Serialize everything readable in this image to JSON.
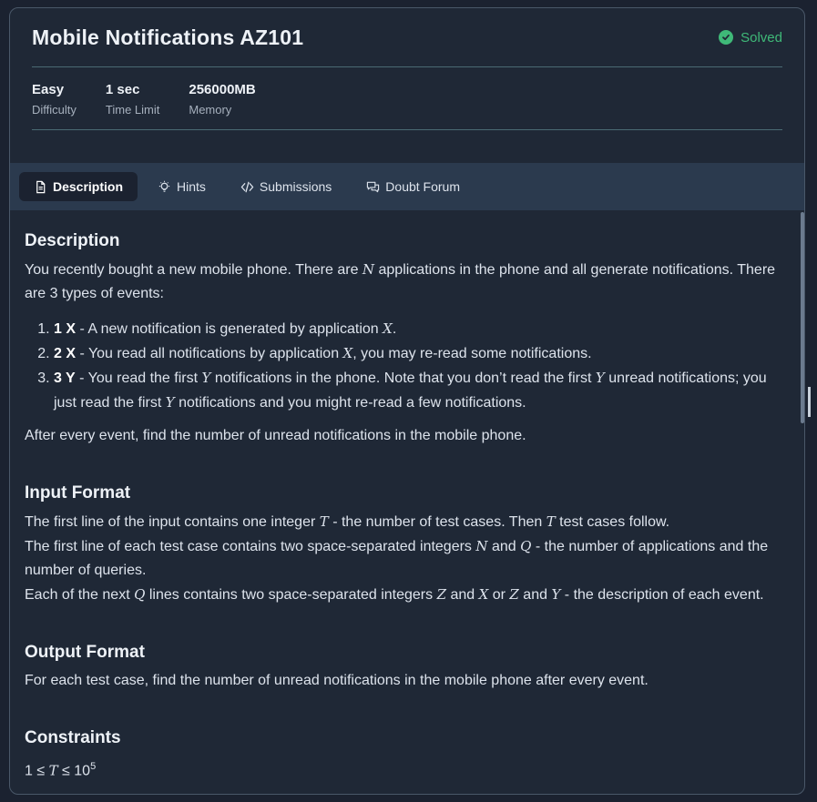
{
  "problem": {
    "title": "Mobile Notifications AZ101",
    "status": "Solved",
    "meta": [
      {
        "value": "Easy",
        "label": "Difficulty"
      },
      {
        "value": "1 sec",
        "label": "Time Limit"
      },
      {
        "value": "256000MB",
        "label": "Memory"
      }
    ]
  },
  "tabs": [
    {
      "label": "Description",
      "icon": "document-icon"
    },
    {
      "label": "Hints",
      "icon": "lightbulb-icon"
    },
    {
      "label": "Submissions",
      "icon": "code-icon"
    },
    {
      "label": "Doubt Forum",
      "icon": "chat-icon"
    }
  ],
  "description": {
    "heading": "Description",
    "intro_1": "You recently bought a new mobile phone. There are ",
    "var_n": "N",
    "intro_2": " applications in the phone and all generate notifications. There are 3 types of events:",
    "events": [
      {
        "code": "1 X",
        "text_1": " - A new notification is generated by application ",
        "var": "X",
        "text_2": "."
      },
      {
        "code": "2 X",
        "text_1": " - You read all notifications by application ",
        "var": "X",
        "text_2": ", you may re-read some notifications."
      },
      {
        "code": "3 Y",
        "text_1": " - You read the first ",
        "var": "Y",
        "text_2": " notifications in the phone. Note that you don’t read the first ",
        "var2": "Y",
        "text_3": " unread notifications; you just read the first ",
        "var3": "Y",
        "text_4": " notifications and you might re-read a few notifications."
      }
    ],
    "outro": "After every event, find the number of unread notifications in the mobile phone."
  },
  "input_format": {
    "heading": "Input Format",
    "line1_a": "The first line of the input contains one integer ",
    "line1_v1": "T",
    "line1_b": " - the number of test cases. Then ",
    "line1_v2": "T",
    "line1_c": " test cases follow.",
    "line2_a": "The first line of each test case contains two space-separated integers ",
    "line2_v1": "N",
    "line2_b": " and ",
    "line2_v2": "Q",
    "line2_c": " - the number of applications and the number of queries.",
    "line3_a": "Each of the next ",
    "line3_v1": "Q",
    "line3_b": " lines contains two space-separated integers ",
    "line3_v2": "Z",
    "line3_c": " and ",
    "line3_v3": "X",
    "line3_d": " or ",
    "line3_v4": "Z",
    "line3_e": " and ",
    "line3_v5": "Y",
    "line3_f": " - the description of each event."
  },
  "output_format": {
    "heading": "Output Format",
    "text": "For each test case, find the number of unread notifications in the mobile phone after every event."
  },
  "constraints": {
    "heading": "Constraints",
    "c1_a": "1 ≤ ",
    "c1_v": "T",
    "c1_b": " ≤ 10",
    "c1_exp": "5"
  },
  "colors": {
    "accent_green": "#3fb978",
    "tab_bar": "#2b3a4e",
    "panel": "#1f2836"
  }
}
